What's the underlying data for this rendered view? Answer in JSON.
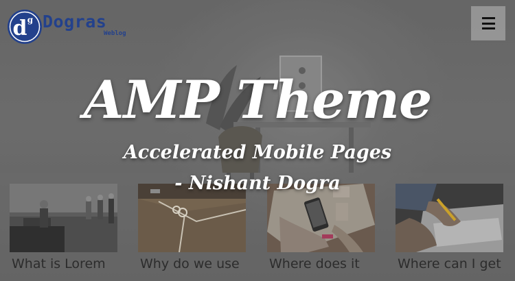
{
  "header": {
    "logo_name": "Dogras",
    "logo_sub": "Weblog",
    "logo_monogram": "d",
    "logo_monogram_mark": "g",
    "menu_icon": "hamburger-icon"
  },
  "hero": {
    "title": "AMP Theme",
    "subtitle": "Accelerated Mobile Pages",
    "author": "- Nishant Dogra"
  },
  "posts": [
    {
      "title": "What is Lorem",
      "thumbnail": "office-people-image"
    },
    {
      "title": "Why do we use",
      "thumbnail": "cardboard-box-image"
    },
    {
      "title": "Where does it",
      "thumbnail": "phone-sketch-image"
    },
    {
      "title": "Where can I get",
      "thumbnail": "hand-writing-image"
    }
  ],
  "colors": {
    "brand_blue": "#23418c",
    "hero_text": "#ffffff",
    "card_text": "#2c2c2c"
  }
}
